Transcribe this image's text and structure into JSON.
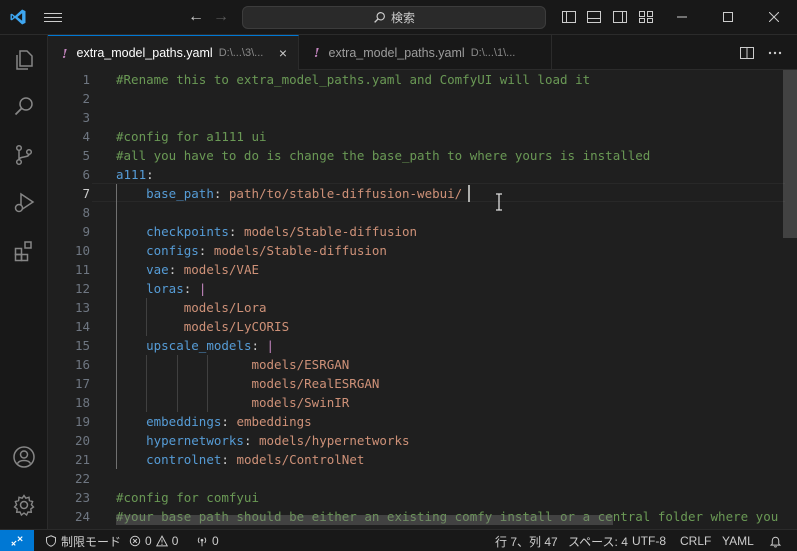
{
  "search": {
    "label": "検索"
  },
  "tabs": [
    {
      "filename": "extra_model_paths.yaml",
      "path": "D:\\...\\3\\...",
      "active": true
    },
    {
      "filename": "extra_model_paths.yaml",
      "path": "D:\\...\\1\\...",
      "active": false
    }
  ],
  "editor": {
    "lines": [
      {
        "n": "1",
        "tokens": [
          {
            "t": "#Rename this to extra_model_paths.yaml and ComfyUI will load it",
            "c": "comment"
          }
        ]
      },
      {
        "n": "2",
        "tokens": []
      },
      {
        "n": "3",
        "tokens": []
      },
      {
        "n": "4",
        "tokens": [
          {
            "t": "#config for a1111 ui",
            "c": "comment"
          }
        ]
      },
      {
        "n": "5",
        "tokens": [
          {
            "t": "#all you have to do is change the base_path to where yours is installed",
            "c": "comment"
          }
        ]
      },
      {
        "n": "6",
        "tokens": [
          {
            "t": "a111",
            "c": "key"
          },
          {
            "t": ":",
            "c": "punc"
          }
        ]
      },
      {
        "n": "7",
        "tokens": [
          {
            "t": "    ",
            "c": "punc"
          },
          {
            "t": "base_path",
            "c": "key"
          },
          {
            "t": ": ",
            "c": "punc"
          },
          {
            "t": "path/to/stable-diffusion-webui/",
            "c": "str"
          }
        ]
      },
      {
        "n": "8",
        "tokens": []
      },
      {
        "n": "9",
        "tokens": [
          {
            "t": "    ",
            "c": "punc"
          },
          {
            "t": "checkpoints",
            "c": "key"
          },
          {
            "t": ": ",
            "c": "punc"
          },
          {
            "t": "models/Stable-diffusion",
            "c": "str"
          }
        ]
      },
      {
        "n": "10",
        "tokens": [
          {
            "t": "    ",
            "c": "punc"
          },
          {
            "t": "configs",
            "c": "key"
          },
          {
            "t": ": ",
            "c": "punc"
          },
          {
            "t": "models/Stable-diffusion",
            "c": "str"
          }
        ]
      },
      {
        "n": "11",
        "tokens": [
          {
            "t": "    ",
            "c": "punc"
          },
          {
            "t": "vae",
            "c": "key"
          },
          {
            "t": ": ",
            "c": "punc"
          },
          {
            "t": "models/VAE",
            "c": "str"
          }
        ]
      },
      {
        "n": "12",
        "tokens": [
          {
            "t": "    ",
            "c": "punc"
          },
          {
            "t": "loras",
            "c": "key"
          },
          {
            "t": ": ",
            "c": "punc"
          },
          {
            "t": "|",
            "c": "pipe"
          }
        ]
      },
      {
        "n": "13",
        "tokens": [
          {
            "t": "         ",
            "c": "punc"
          },
          {
            "t": "models/Lora",
            "c": "str"
          }
        ]
      },
      {
        "n": "14",
        "tokens": [
          {
            "t": "         ",
            "c": "punc"
          },
          {
            "t": "models/LyCORIS",
            "c": "str"
          }
        ]
      },
      {
        "n": "15",
        "tokens": [
          {
            "t": "    ",
            "c": "punc"
          },
          {
            "t": "upscale_models",
            "c": "key"
          },
          {
            "t": ": ",
            "c": "punc"
          },
          {
            "t": "|",
            "c": "pipe"
          }
        ]
      },
      {
        "n": "16",
        "tokens": [
          {
            "t": "                  ",
            "c": "punc"
          },
          {
            "t": "models/ESRGAN",
            "c": "str"
          }
        ]
      },
      {
        "n": "17",
        "tokens": [
          {
            "t": "                  ",
            "c": "punc"
          },
          {
            "t": "models/RealESRGAN",
            "c": "str"
          }
        ]
      },
      {
        "n": "18",
        "tokens": [
          {
            "t": "                  ",
            "c": "punc"
          },
          {
            "t": "models/SwinIR",
            "c": "str"
          }
        ]
      },
      {
        "n": "19",
        "tokens": [
          {
            "t": "    ",
            "c": "punc"
          },
          {
            "t": "embeddings",
            "c": "key"
          },
          {
            "t": ": ",
            "c": "punc"
          },
          {
            "t": "embeddings",
            "c": "str"
          }
        ]
      },
      {
        "n": "20",
        "tokens": [
          {
            "t": "    ",
            "c": "punc"
          },
          {
            "t": "hypernetworks",
            "c": "key"
          },
          {
            "t": ": ",
            "c": "punc"
          },
          {
            "t": "models/hypernetworks",
            "c": "str"
          }
        ]
      },
      {
        "n": "21",
        "tokens": [
          {
            "t": "    ",
            "c": "punc"
          },
          {
            "t": "controlnet",
            "c": "key"
          },
          {
            "t": ": ",
            "c": "punc"
          },
          {
            "t": "models/ControlNet",
            "c": "str"
          }
        ]
      },
      {
        "n": "22",
        "tokens": []
      },
      {
        "n": "23",
        "tokens": [
          {
            "t": "#config for comfyui",
            "c": "comment"
          }
        ]
      },
      {
        "n": "24",
        "tokens": [
          {
            "t": "#your base path should be either an existing comfy install or a central folder where you",
            "c": "comment"
          }
        ]
      }
    ],
    "current_line": "7"
  },
  "statusbar": {
    "restricted_mode": "制限モード",
    "errors": "0",
    "warnings": "0",
    "ports": "0",
    "cursor_position": "行 7、列 47",
    "indentation": "スペース: 4",
    "encoding": "UTF-8",
    "eol": "CRLF",
    "language": "YAML"
  },
  "colors": {
    "accent": "#0078d4",
    "comment": "#6a9955",
    "key": "#569cd6",
    "string": "#ce9178",
    "yaml_icon": "#c586c0"
  }
}
